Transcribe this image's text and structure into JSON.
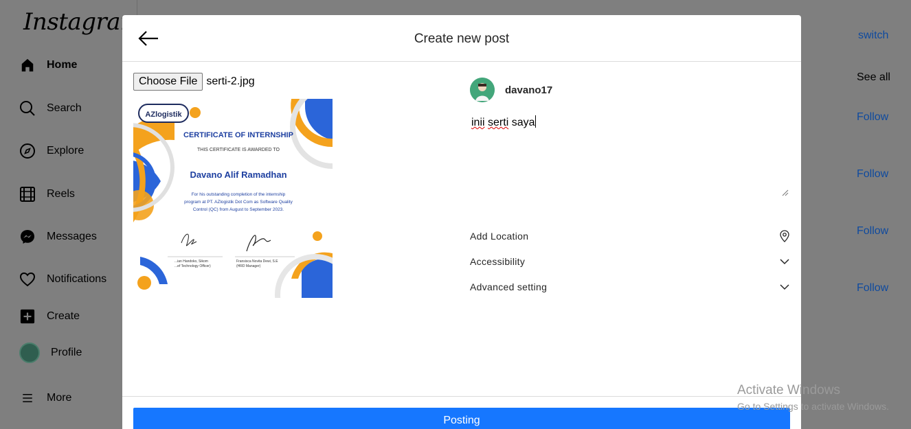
{
  "app": {
    "logo_text": "Instagram"
  },
  "sidebar": {
    "items": [
      {
        "label": "Home",
        "icon": "home-icon"
      },
      {
        "label": "Search",
        "icon": "search-icon"
      },
      {
        "label": "Explore",
        "icon": "compass-icon"
      },
      {
        "label": "Reels",
        "icon": "reels-icon"
      },
      {
        "label": "Messages",
        "icon": "messenger-icon"
      },
      {
        "label": "Notifications",
        "icon": "heart-icon"
      },
      {
        "label": "Create",
        "icon": "plus-square-icon"
      },
      {
        "label": "Profile",
        "icon": "avatar"
      },
      {
        "label": "More",
        "icon": "menu-icon"
      }
    ]
  },
  "right_panel": {
    "switch_label": "switch",
    "see_all_label": "See all",
    "follow_labels": [
      "Follow",
      "Follow",
      "Follow",
      "Follow"
    ]
  },
  "modal": {
    "title": "Create new post",
    "back_icon": "arrow-left-icon",
    "file_button_label": "Choose File",
    "file_name": "serti-2.jpg",
    "username": "davano17",
    "caption": {
      "word1": "inii",
      "word2": "serti",
      "word3": "saya"
    },
    "options": [
      {
        "label": "Add Location",
        "icon": "location-pin-icon"
      },
      {
        "label": "Accessibility",
        "icon": "chevron-down-icon"
      },
      {
        "label": "Advanced setting",
        "icon": "chevron-down-icon"
      }
    ],
    "post_button_label": "Posting"
  },
  "certificate": {
    "brand": "AZlogistik",
    "heading": "CERTIFICATE OF INTERNSHIP",
    "awarded": "THIS CERTIFICATE IS AWARDED TO",
    "recipient": "Davano Alif Ramadhan",
    "body1": "For his outstanding completion of the internship",
    "body2": "program at PT. AZlogistik Dot Com as Software Quality",
    "body3": "Control (QC) from August to September 2023.",
    "sig1_name": "...ian Handoko, Sikom",
    "sig1_role": "...ef Technology Officer)",
    "sig2_name": "Fransisca Novita Dewi, S.E",
    "sig2_role": "(HRD Manager)"
  },
  "watermark": {
    "line1": "Activate Windows",
    "line2": "Go to Settings to activate Windows."
  },
  "colors": {
    "primary_button": "#1677ff",
    "overlay": "#7f7f7f",
    "link": "#0e4a9f"
  }
}
